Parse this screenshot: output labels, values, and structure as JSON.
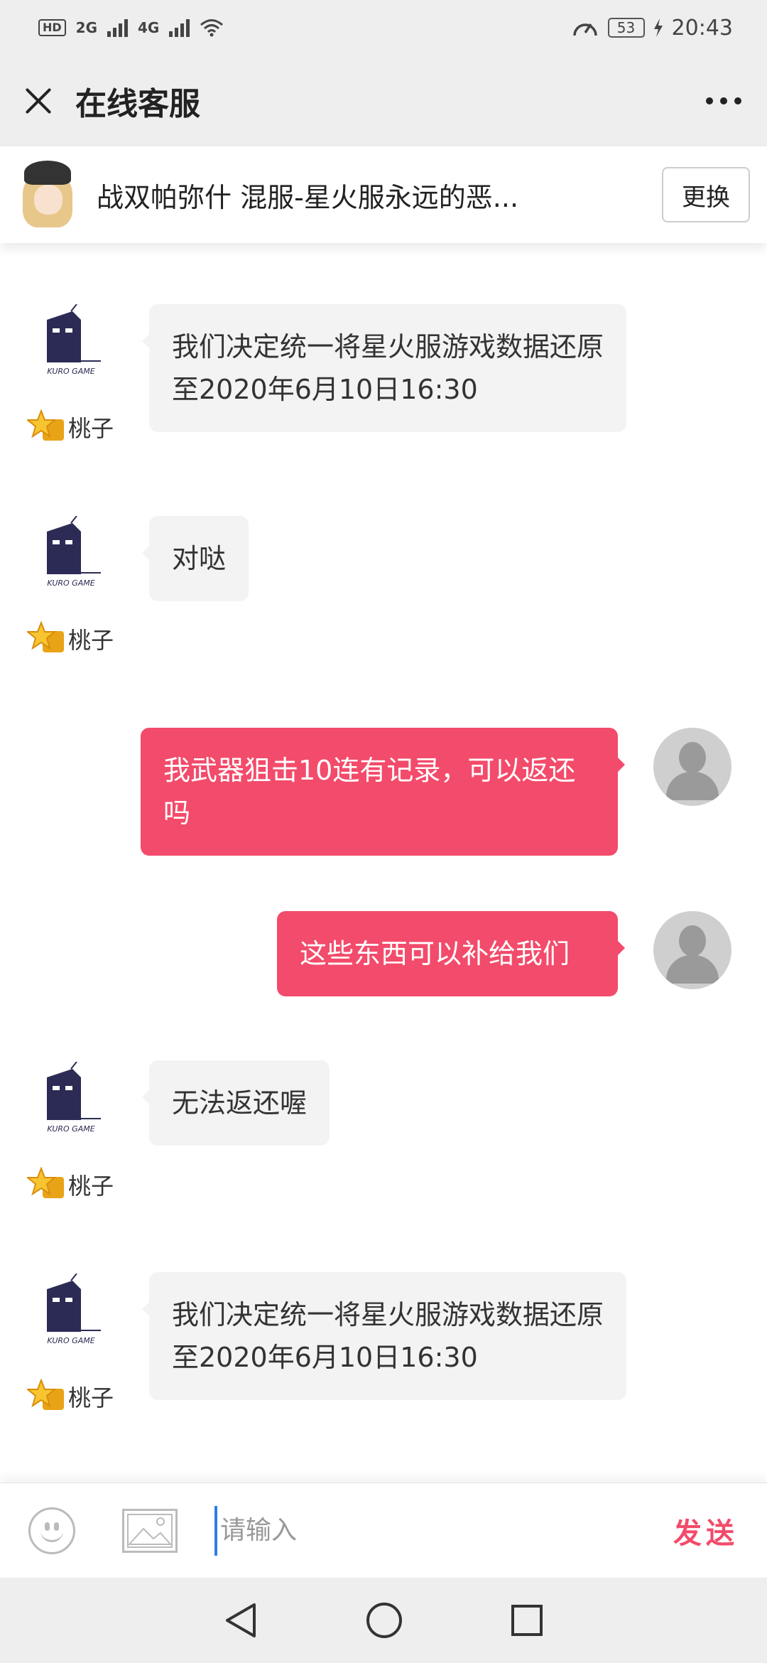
{
  "status_bar": {
    "hd_label": "HD",
    "sim1": "2G",
    "sim2": "4G",
    "battery_level": "53",
    "time": "20:43"
  },
  "header": {
    "title": "在线客服",
    "close_icon": "close-icon",
    "more_icon": "more-icon"
  },
  "game_bar": {
    "game_name": "战双帕弥什  混服-星火服永远的恶...",
    "change_label": "更换"
  },
  "messages": [
    {
      "from": "agent",
      "text": "我们决定统一将星火服游戏数据还原至2020年6月10日16:30",
      "agent_name": "桃子"
    },
    {
      "from": "agent",
      "text": "对哒",
      "agent_name": "桃子"
    },
    {
      "from": "user",
      "text": "我武器狙击10连有记录，可以返还吗"
    },
    {
      "from": "user",
      "text": "这些东西可以补给我们"
    },
    {
      "from": "agent",
      "text": "无法返还喔",
      "agent_name": "桃子"
    },
    {
      "from": "agent",
      "text": "我们决定统一将星火服游戏数据还原至2020年6月10日16:30",
      "agent_name": "桃子"
    }
  ],
  "agent_logo_text": "KURO GAME",
  "input_bar": {
    "placeholder": "请输入",
    "send_label": "发送"
  },
  "colors": {
    "accent": "#f34b6b",
    "incoming_bubble": "#f3f3f3",
    "bar_background": "#eeeeee"
  }
}
